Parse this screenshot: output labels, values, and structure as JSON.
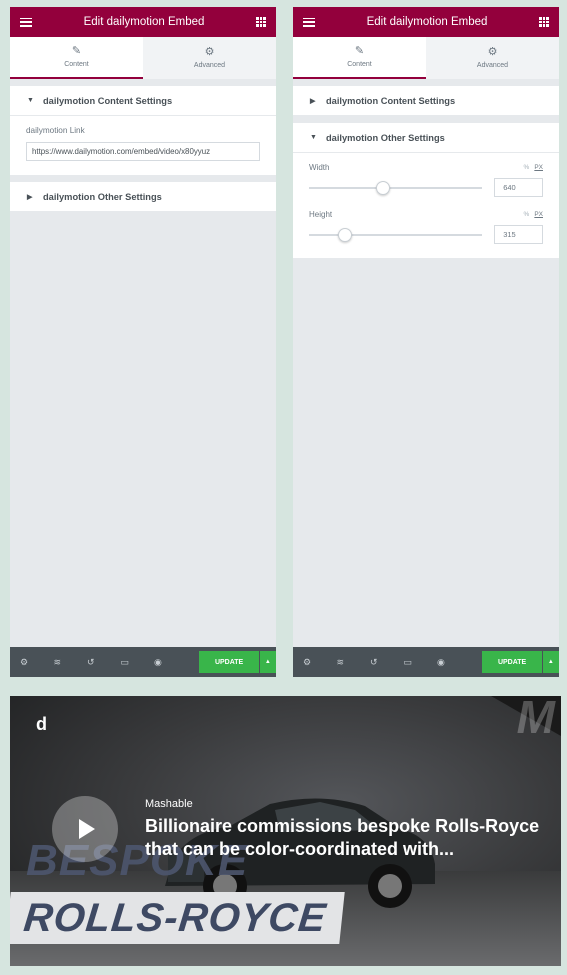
{
  "panels": [
    {
      "header": {
        "title": "Edit dailymotion Embed"
      },
      "tabs": [
        {
          "label": "Content",
          "icon": "pencil-icon",
          "active": true
        },
        {
          "label": "Advanced",
          "icon": "gear-icon",
          "active": false
        }
      ],
      "sections": [
        {
          "title": "dailymotion Content Settings",
          "expanded": true,
          "controls": [
            {
              "label": "dailymotion Link",
              "value": "https://www.dailymotion.com/embed/video/x80yyuz"
            }
          ]
        },
        {
          "title": "dailymotion Other Settings",
          "expanded": false
        }
      ]
    },
    {
      "header": {
        "title": "Edit dailymotion Embed"
      },
      "tabs": [
        {
          "label": "Content",
          "icon": "pencil-icon",
          "active": true
        },
        {
          "label": "Advanced",
          "icon": "gear-icon",
          "active": false
        }
      ],
      "sections": [
        {
          "title": "dailymotion Content Settings",
          "expanded": false
        },
        {
          "title": "dailymotion Other Settings",
          "expanded": true,
          "controls": [
            {
              "label": "Width",
              "value": "640",
              "unit_percent": "%",
              "unit_px": "PX",
              "slider_fraction": 0.43
            },
            {
              "label": "Height",
              "value": "315",
              "unit_percent": "%",
              "unit_px": "PX",
              "slider_fraction": 0.21
            }
          ]
        }
      ]
    }
  ],
  "footer": {
    "icons": [
      "settings-icon",
      "layers-icon",
      "history-icon",
      "responsive-icon",
      "eye-icon"
    ],
    "update_label": "UPDATE"
  },
  "video": {
    "logo": "d",
    "watermark": "M",
    "source": "Mashable",
    "title": "Billionaire commissions bespoke Rolls-Royce that can be color-coordinated with...",
    "overlay_line1": "BESPOKE",
    "overlay_line2": "ROLLS-ROYCE"
  },
  "colors": {
    "header": "#93003c",
    "update": "#39b54a",
    "footer": "#495157"
  }
}
